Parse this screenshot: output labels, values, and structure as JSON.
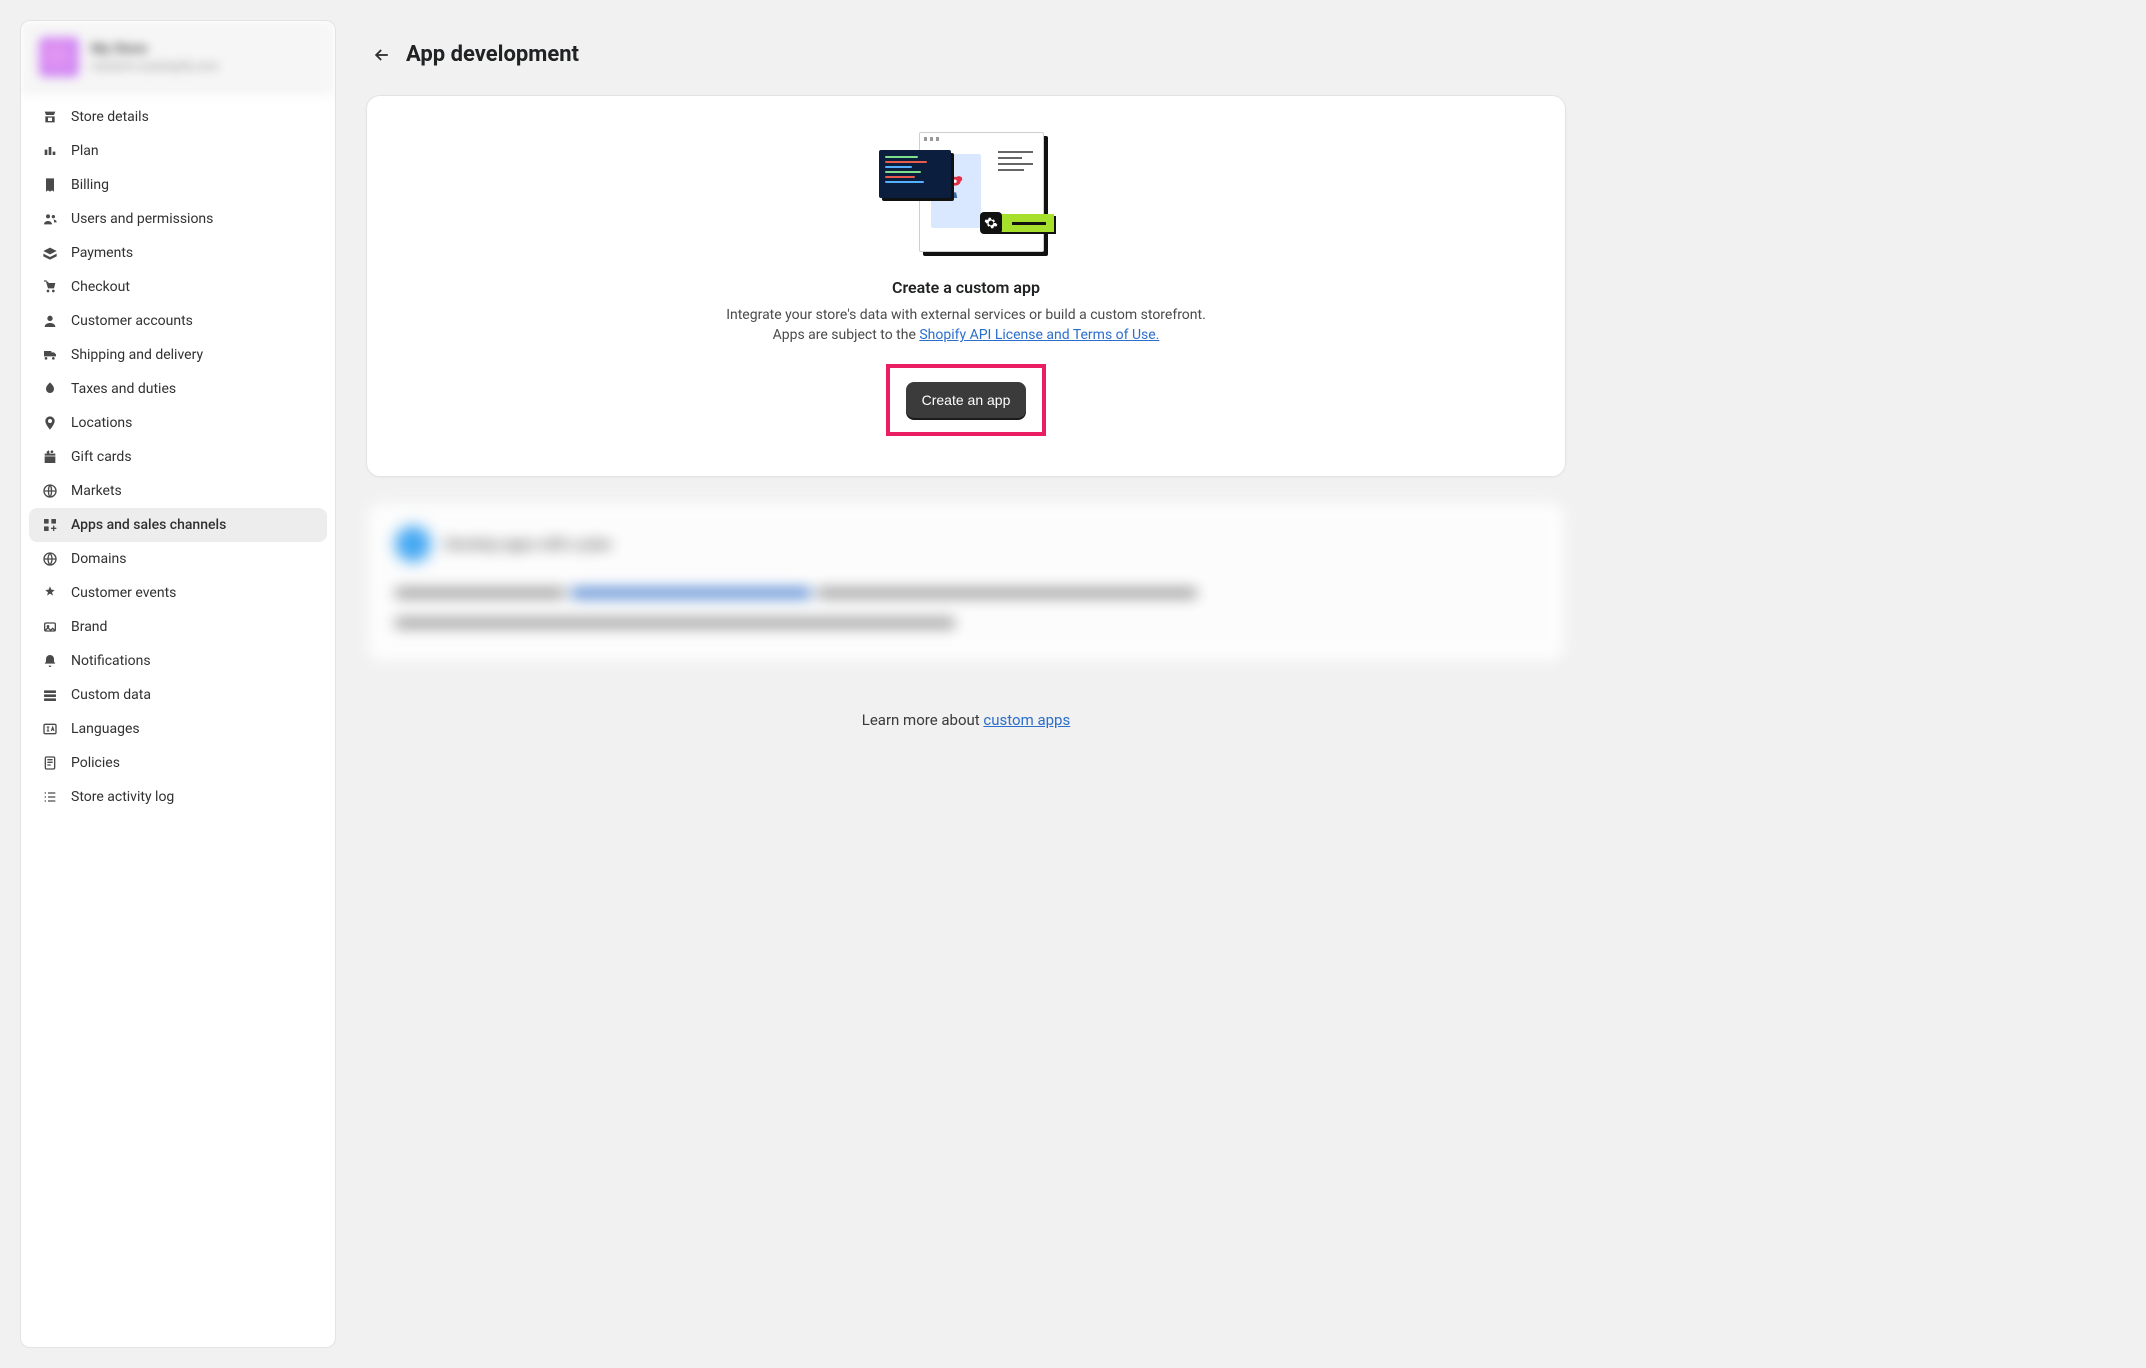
{
  "sidebar": {
    "store_name": "My Store",
    "store_url": "mystore.myshopify.com",
    "items": [
      {
        "icon": "store",
        "label": "Store details"
      },
      {
        "icon": "plan",
        "label": "Plan"
      },
      {
        "icon": "billing",
        "label": "Billing"
      },
      {
        "icon": "users",
        "label": "Users and permissions"
      },
      {
        "icon": "payments",
        "label": "Payments"
      },
      {
        "icon": "checkout",
        "label": "Checkout"
      },
      {
        "icon": "customer",
        "label": "Customer accounts"
      },
      {
        "icon": "shipping",
        "label": "Shipping and delivery"
      },
      {
        "icon": "taxes",
        "label": "Taxes and duties"
      },
      {
        "icon": "locations",
        "label": "Locations"
      },
      {
        "icon": "gift",
        "label": "Gift cards"
      },
      {
        "icon": "markets",
        "label": "Markets"
      },
      {
        "icon": "apps",
        "label": "Apps and sales channels",
        "active": true
      },
      {
        "icon": "domains",
        "label": "Domains"
      },
      {
        "icon": "events",
        "label": "Customer events"
      },
      {
        "icon": "brand",
        "label": "Brand"
      },
      {
        "icon": "notifications",
        "label": "Notifications"
      },
      {
        "icon": "customdata",
        "label": "Custom data"
      },
      {
        "icon": "languages",
        "label": "Languages"
      },
      {
        "icon": "policies",
        "label": "Policies"
      },
      {
        "icon": "activity",
        "label": "Store activity log"
      }
    ]
  },
  "page": {
    "title": "App development"
  },
  "hero": {
    "title": "Create a custom app",
    "desc_prefix": "Integrate your store's data with external services or build a custom storefront. Apps are subject to the ",
    "desc_link": "Shopify API License and Terms of Use.",
    "button": "Create an app"
  },
  "learn_more": {
    "prefix": "Learn more about ",
    "link": "custom apps"
  }
}
